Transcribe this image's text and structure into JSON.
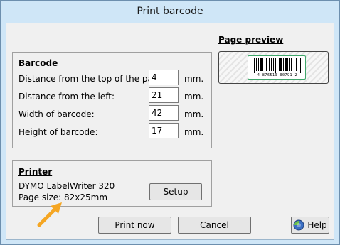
{
  "window": {
    "title": "Print barcode"
  },
  "barcode_group": {
    "title": "Barcode",
    "fields": [
      {
        "label": "Distance from the top of the page:",
        "value": "4",
        "unit": "mm."
      },
      {
        "label": "Distance from the left:",
        "value": "21",
        "unit": "mm."
      },
      {
        "label": "Width of barcode:",
        "value": "42",
        "unit": "mm."
      },
      {
        "label": "Height of barcode:",
        "value": "17",
        "unit": "mm."
      }
    ]
  },
  "printer_group": {
    "title": "Printer",
    "printer_name": "DYMO LabelWriter 320",
    "page_size": "Page size: 82x25mm",
    "setup_label": "Setup"
  },
  "preview": {
    "title": "Page preview",
    "barcode_number": "4 876519 00791 2"
  },
  "buttons": {
    "print_now": "Print now",
    "cancel": "Cancel",
    "help": "Help"
  },
  "colors": {
    "title_bar": "#cfe6f7",
    "dialog_bg": "#f0f0f0",
    "annotation_arrow": "#f5a623",
    "label_border": "#3fa66a"
  },
  "icons": [
    "help-icon",
    "arrow-annotation-icon"
  ]
}
